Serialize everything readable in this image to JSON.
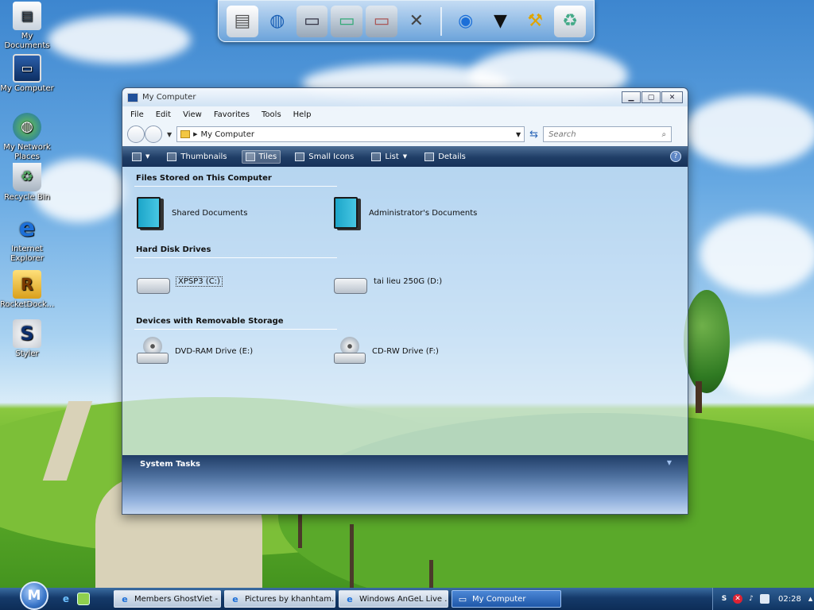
{
  "desktop": {
    "icons": [
      {
        "label": "My Documents",
        "icon": "my-documents-icon"
      },
      {
        "label": "My Computer",
        "icon": "my-computer-icon"
      },
      {
        "label": "My Network Places",
        "icon": "network-places-icon"
      },
      {
        "label": "Recycle Bin",
        "icon": "recycle-bin-icon"
      },
      {
        "label": "Internet Explorer",
        "icon": "internet-explorer-icon"
      },
      {
        "label": "RocketDock...",
        "icon": "rocketdock-icon"
      },
      {
        "label": "Styler",
        "icon": "styler-icon"
      }
    ]
  },
  "dock": {
    "items": [
      "notepad-icon",
      "network-icon",
      "folder-documents-icon",
      "folder-pictures-icon",
      "folder-photos-icon",
      "tools-icon",
      "globe-icon",
      "tshirt-icon",
      "hammer-icon",
      "recycle-bin-icon"
    ]
  },
  "window": {
    "title": "My Computer",
    "menu": [
      "File",
      "Edit",
      "View",
      "Favorites",
      "Tools",
      "Help"
    ],
    "address": "My Computer",
    "search_placeholder": "Search",
    "toolbar": {
      "thumbnails": "Thumbnails",
      "tiles": "Tiles",
      "small_icons": "Small Icons",
      "list": "List",
      "details": "Details"
    },
    "groups": [
      {
        "title": "Files Stored on This Computer",
        "items": [
          "Shared Documents",
          "Administrator's Documents"
        ]
      },
      {
        "title": "Hard Disk Drives",
        "items": [
          "XPSP3 (C:)",
          "tai lieu 250G (D:)"
        ]
      },
      {
        "title": "Devices with Removable Storage",
        "items": [
          "DVD-RAM Drive (E:)",
          "CD-RW Drive (F:)"
        ]
      }
    ],
    "system_tasks": "System Tasks"
  },
  "taskbar": {
    "start_label": "M",
    "buttons": [
      {
        "label": "Members GhostViet - ...",
        "active": false
      },
      {
        "label": "Pictures by khanhtam...",
        "active": false
      },
      {
        "label": "Windows AnGeL Live ...",
        "active": false
      },
      {
        "label": "My Computer",
        "active": true
      }
    ],
    "clock": "02:28"
  },
  "colors": {
    "toolbar_dark": "#1f3d66",
    "task_active": "#1e57a8",
    "sky": "#66a8e2",
    "grass": "#5fae2a"
  }
}
